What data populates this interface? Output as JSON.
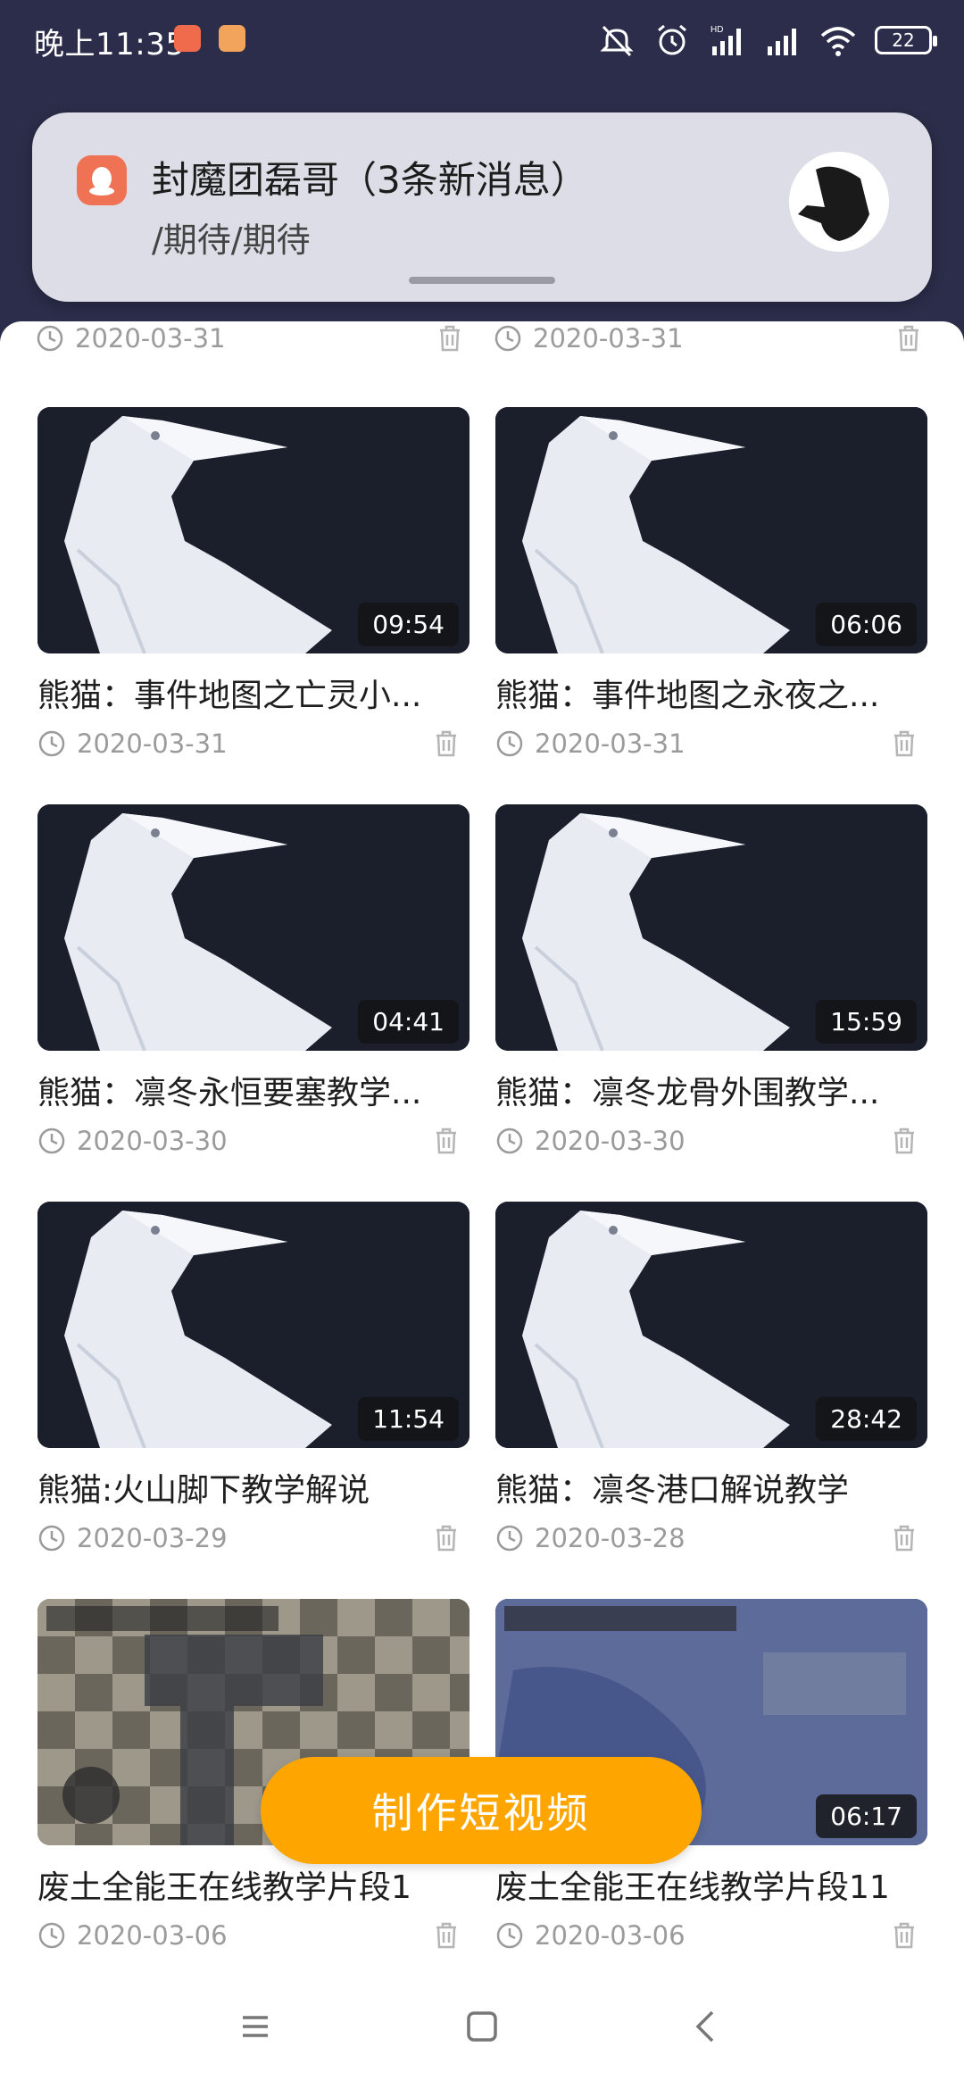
{
  "status_bar": {
    "time": "晚上11:35",
    "battery": "22",
    "icons": [
      "qq-notification-icon",
      "app-notification-icon",
      "mute-icon",
      "alarm-icon",
      "signal-hd-icon",
      "signal-icon",
      "wifi-icon",
      "battery-icon"
    ]
  },
  "notification": {
    "title": "封魔团磊哥（3条新消息）",
    "body": "/期待/期待",
    "app_icon": "qq-icon",
    "avatar": "contact-avatar"
  },
  "top_row": [
    {
      "date": "2020-03-31"
    },
    {
      "date": "2020-03-31"
    }
  ],
  "videos": [
    {
      "duration": "09:54",
      "title": "熊猫：事件地图之亡灵小...",
      "date": "2020-03-31",
      "thumb": "crow"
    },
    {
      "duration": "06:06",
      "title": "熊猫：事件地图之永夜之...",
      "date": "2020-03-31",
      "thumb": "crow"
    },
    {
      "duration": "04:41",
      "title": "熊猫：凛冬永恒要塞教学...",
      "date": "2020-03-30",
      "thumb": "crow"
    },
    {
      "duration": "15:59",
      "title": "熊猫：凛冬龙骨外围教学...",
      "date": "2020-03-30",
      "thumb": "crow"
    },
    {
      "duration": "11:54",
      "title": "熊猫:火山脚下教学解说",
      "date": "2020-03-29",
      "thumb": "crow"
    },
    {
      "duration": "28:42",
      "title": "熊猫：凛冬港口解说教学",
      "date": "2020-03-28",
      "thumb": "crow"
    },
    {
      "duration": "",
      "title": "废土全能王在线教学片段1",
      "date": "2020-03-06",
      "thumb": "game"
    },
    {
      "duration": "06:17",
      "title": "废土全能王在线教学片段11",
      "date": "2020-03-06",
      "thumb": "game2"
    }
  ],
  "make_button": "制作短视频",
  "nav": [
    "menu-icon",
    "home-icon",
    "back-icon"
  ],
  "colors": {
    "accent": "#ffa500",
    "header_bg": "#2b2d4a",
    "date_text": "#9b9b9b"
  }
}
